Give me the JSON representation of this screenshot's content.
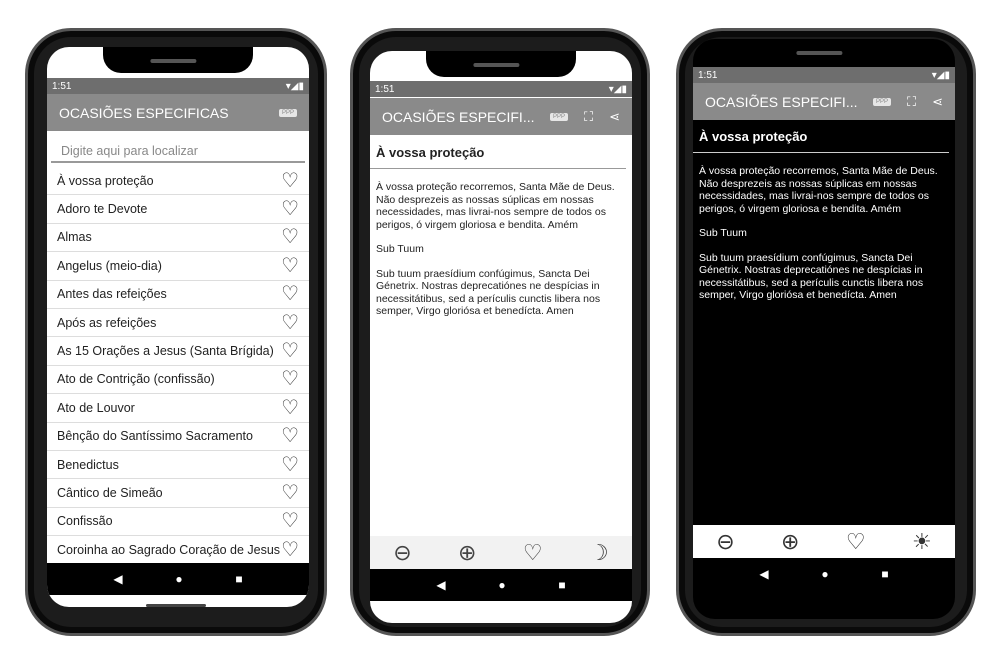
{
  "status": {
    "time": "1:51",
    "left_icons": "⚙ ● ◎",
    "right_icons": "▾◢▮"
  },
  "app_title": "OCASIÕES ESPECIFICAS",
  "app_title_short": "OCASIÕES ESPECIFI...",
  "badge": "PPP",
  "search_placeholder": "Digite aqui para localizar",
  "list": [
    "À vossa proteção",
    "Adoro te Devote",
    "Almas",
    "Angelus (meio-dia)",
    "Antes das refeições",
    "Após as refeições",
    "As 15 Orações a Jesus (Santa Brígida)",
    "Ato de Contrição (confissão)",
    "Ato de Louvor",
    "Bênção do Santíssimo Sacramento",
    "Benedictus",
    "Cântico de Simeão",
    "Confissão",
    "Coroinha ao Sagrado Coração de Jesus"
  ],
  "prayer": {
    "title": "À vossa proteção",
    "p1": "À vossa proteção recorremos, Santa Mãe de Deus. Não desprezeis as nossas súplicas em nossas necessidades, mas livrai-nos sempre de todos os perigos, ó virgem gloriosa e bendita. Amém",
    "sub": "Sub Tuum",
    "p2": "Sub tuum praesídium confúgimus, Sancta Dei Génetrix. Nostras deprecatiónes ne despícias in necessitátibus, sed a perículis cunctis libera nos semper, Virgo gloriósa et benedícta. Amen"
  },
  "icons": {
    "zoom_out": "zoom-out",
    "zoom_in": "zoom-in",
    "favorite": "heart",
    "night": "moon",
    "day": "sun",
    "fullscreen": "fullscreen",
    "share": "share"
  },
  "colors": {
    "appbar": "#8a8a8a",
    "status": "#6e6e6e",
    "dark_bg": "#000000"
  }
}
